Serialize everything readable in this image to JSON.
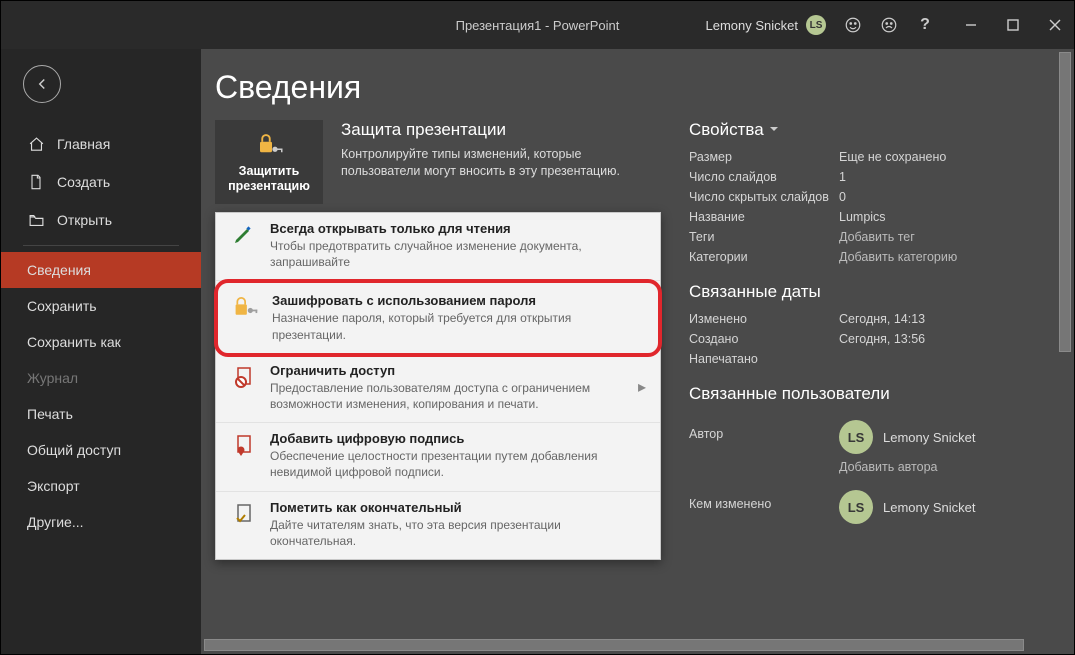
{
  "titlebar": {
    "title": "Презентация1 - PowerPoint",
    "user_name": "Lemony Snicket",
    "user_initials": "LS"
  },
  "sidebar": {
    "back": "Назад",
    "items": [
      {
        "icon": "home",
        "label": "Главная"
      },
      {
        "icon": "file",
        "label": "Создать"
      },
      {
        "icon": "folder",
        "label": "Открыть"
      }
    ],
    "section2": [
      {
        "label": "Сведения",
        "active": true
      },
      {
        "label": "Сохранить"
      },
      {
        "label": "Сохранить как"
      },
      {
        "label": "Журнал",
        "disabled": true
      },
      {
        "label": "Печать"
      },
      {
        "label": "Общий доступ"
      },
      {
        "label": "Экспорт"
      },
      {
        "label": "Другие..."
      }
    ]
  },
  "page": {
    "title": "Сведения"
  },
  "protect": {
    "button_label": "Защитить презентацию",
    "heading": "Защита презентации",
    "description": "Контролируйте типы изменений, которые пользователи могут вносить в эту презентацию."
  },
  "menu": [
    {
      "icon": "pen",
      "title": "Всегда открывать только для чтения",
      "sub": "Чтобы предотвратить случайное изменение документа, запрашивайте"
    },
    {
      "icon": "lock-key",
      "title": "Зашифровать с использованием пароля",
      "sub": "Назначение пароля, который требуется для открытия презентации.",
      "highlight": true
    },
    {
      "icon": "no-entry",
      "title": "Ограничить доступ",
      "sub": "Предоставление пользователям доступа с ограничением возможности изменения, копирования и печати."
    },
    {
      "icon": "ribbon",
      "title": "Добавить цифровую подпись",
      "sub": "Обеспечение целостности презентации путем добавления невидимой цифровой подписи."
    },
    {
      "icon": "final",
      "title": "Пометить как окончательный",
      "sub": "Дайте читателям знать, что эта версия презентации окончательная."
    }
  ],
  "props": {
    "title": "Свойства",
    "rows": [
      {
        "k": "Размер",
        "v": "Еще не сохранено"
      },
      {
        "k": "Число слайдов",
        "v": "1"
      },
      {
        "k": "Число скрытых слайдов",
        "v": "0"
      },
      {
        "k": "Название",
        "v": "Lumpics"
      },
      {
        "k": "Теги",
        "v": "Добавить тег",
        "link": true
      },
      {
        "k": "Категории",
        "v": "Добавить категорию",
        "link": true
      }
    ]
  },
  "dates": {
    "title": "Связанные даты",
    "rows": [
      {
        "k": "Изменено",
        "v": "Сегодня, 14:13"
      },
      {
        "k": "Создано",
        "v": "Сегодня, 13:56"
      },
      {
        "k": "Напечатано",
        "v": ""
      }
    ]
  },
  "people": {
    "title": "Связанные пользователи",
    "author_label": "Автор",
    "author_name": "Lemony Snicket",
    "author_initials": "LS",
    "add_author": "Добавить автора",
    "changed_label": "Кем изменено",
    "changed_name": "Lemony Snicket",
    "changed_initials": "LS"
  }
}
